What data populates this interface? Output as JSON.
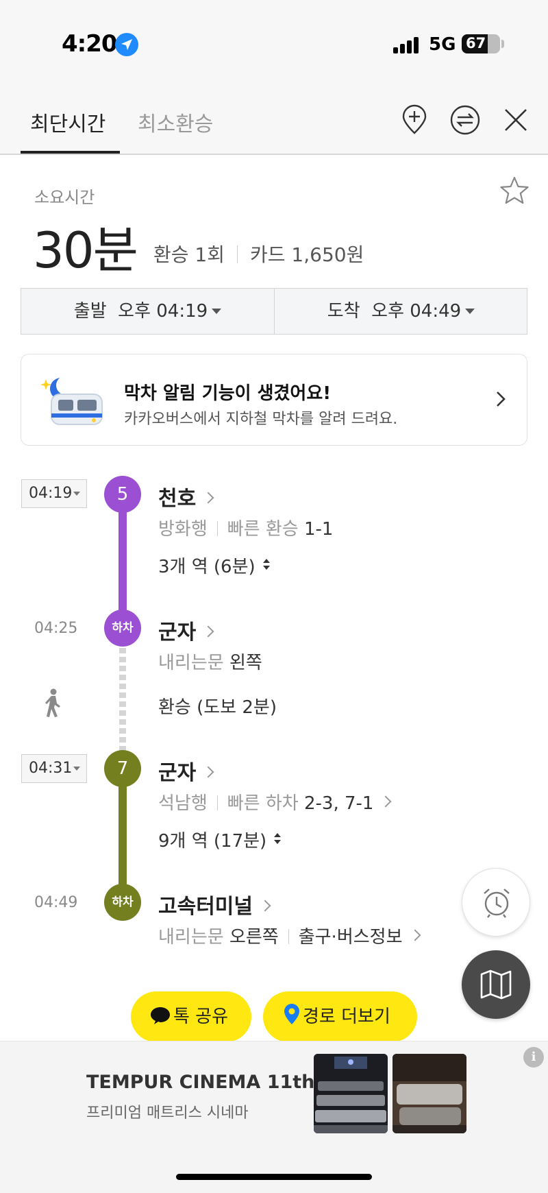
{
  "status_bar": {
    "time": "4:20",
    "network": "5G",
    "battery": "67",
    "battery_level": 0.67
  },
  "tabs": [
    {
      "label": "최단시간",
      "active": true
    },
    {
      "label": "최소환승",
      "active": false
    }
  ],
  "header_icons": [
    "add-waypoint-icon",
    "swap-icon",
    "close-icon"
  ],
  "summary": {
    "label": "소요시간",
    "duration": "30분",
    "transfers": "환승 1회",
    "fare": "카드 1,650원"
  },
  "departure": {
    "label": "출발",
    "time": "오후 04:19"
  },
  "arrival": {
    "label": "도착",
    "time": "오후 04:49"
  },
  "banner": {
    "title": "막차 알림 기능이 생겼어요!",
    "subtitle": "카카오버스에서 지하철 막차를 알려 드려요."
  },
  "route": {
    "leg1": {
      "time": "04:19",
      "line": "5",
      "color": "#9b4fd3",
      "station": "천호",
      "direction": "방화행",
      "quick_label": "빠른 환승",
      "quick_value": "1-1",
      "stops": "3개 역 (6분)"
    },
    "alight1": {
      "time": "04:25",
      "badge": "하차",
      "station": "군자",
      "door_label": "내리는문",
      "door_value": "왼쪽"
    },
    "transfer": {
      "text": "환승 (도보 2분)"
    },
    "leg2": {
      "time": "04:31",
      "line": "7",
      "color": "#747f1f",
      "station": "군자",
      "direction": "석남행",
      "quick_label": "빠른 하차",
      "quick_value": "2-3, 7-1",
      "stops": "9개 역 (17분)"
    },
    "alight2": {
      "time": "04:49",
      "badge": "하차",
      "station": "고속터미널",
      "door_label": "내리는문",
      "door_value": "오른쪽",
      "exit_info": "출구·버스정보"
    }
  },
  "actions": {
    "share_label": "톡 공유",
    "more_label": "경로 더보기"
  },
  "ad": {
    "title": "TEMPUR CINEMA 11th",
    "subtitle": "프리미엄 매트리스 시네마",
    "info": "i"
  }
}
